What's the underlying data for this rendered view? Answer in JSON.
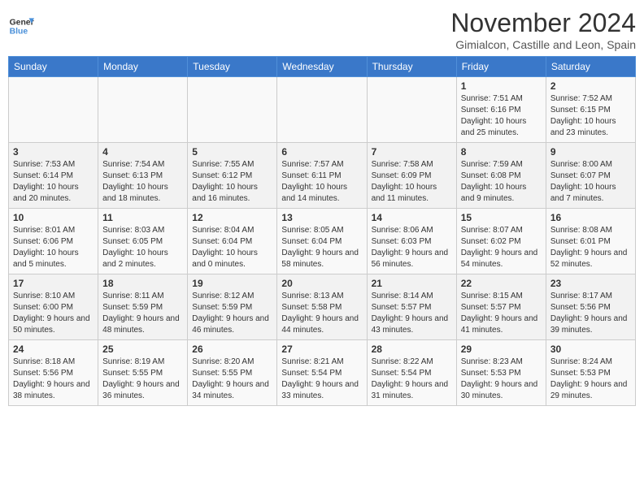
{
  "header": {
    "logo_line1": "General",
    "logo_line2": "Blue",
    "title": "November 2024",
    "subtitle": "Gimialcon, Castille and Leon, Spain"
  },
  "days_of_week": [
    "Sunday",
    "Monday",
    "Tuesday",
    "Wednesday",
    "Thursday",
    "Friday",
    "Saturday"
  ],
  "weeks": [
    [
      {
        "day": "",
        "info": ""
      },
      {
        "day": "",
        "info": ""
      },
      {
        "day": "",
        "info": ""
      },
      {
        "day": "",
        "info": ""
      },
      {
        "day": "",
        "info": ""
      },
      {
        "day": "1",
        "info": "Sunrise: 7:51 AM\nSunset: 6:16 PM\nDaylight: 10 hours and 25 minutes."
      },
      {
        "day": "2",
        "info": "Sunrise: 7:52 AM\nSunset: 6:15 PM\nDaylight: 10 hours and 23 minutes."
      }
    ],
    [
      {
        "day": "3",
        "info": "Sunrise: 7:53 AM\nSunset: 6:14 PM\nDaylight: 10 hours and 20 minutes."
      },
      {
        "day": "4",
        "info": "Sunrise: 7:54 AM\nSunset: 6:13 PM\nDaylight: 10 hours and 18 minutes."
      },
      {
        "day": "5",
        "info": "Sunrise: 7:55 AM\nSunset: 6:12 PM\nDaylight: 10 hours and 16 minutes."
      },
      {
        "day": "6",
        "info": "Sunrise: 7:57 AM\nSunset: 6:11 PM\nDaylight: 10 hours and 14 minutes."
      },
      {
        "day": "7",
        "info": "Sunrise: 7:58 AM\nSunset: 6:09 PM\nDaylight: 10 hours and 11 minutes."
      },
      {
        "day": "8",
        "info": "Sunrise: 7:59 AM\nSunset: 6:08 PM\nDaylight: 10 hours and 9 minutes."
      },
      {
        "day": "9",
        "info": "Sunrise: 8:00 AM\nSunset: 6:07 PM\nDaylight: 10 hours and 7 minutes."
      }
    ],
    [
      {
        "day": "10",
        "info": "Sunrise: 8:01 AM\nSunset: 6:06 PM\nDaylight: 10 hours and 5 minutes."
      },
      {
        "day": "11",
        "info": "Sunrise: 8:03 AM\nSunset: 6:05 PM\nDaylight: 10 hours and 2 minutes."
      },
      {
        "day": "12",
        "info": "Sunrise: 8:04 AM\nSunset: 6:04 PM\nDaylight: 10 hours and 0 minutes."
      },
      {
        "day": "13",
        "info": "Sunrise: 8:05 AM\nSunset: 6:04 PM\nDaylight: 9 hours and 58 minutes."
      },
      {
        "day": "14",
        "info": "Sunrise: 8:06 AM\nSunset: 6:03 PM\nDaylight: 9 hours and 56 minutes."
      },
      {
        "day": "15",
        "info": "Sunrise: 8:07 AM\nSunset: 6:02 PM\nDaylight: 9 hours and 54 minutes."
      },
      {
        "day": "16",
        "info": "Sunrise: 8:08 AM\nSunset: 6:01 PM\nDaylight: 9 hours and 52 minutes."
      }
    ],
    [
      {
        "day": "17",
        "info": "Sunrise: 8:10 AM\nSunset: 6:00 PM\nDaylight: 9 hours and 50 minutes."
      },
      {
        "day": "18",
        "info": "Sunrise: 8:11 AM\nSunset: 5:59 PM\nDaylight: 9 hours and 48 minutes."
      },
      {
        "day": "19",
        "info": "Sunrise: 8:12 AM\nSunset: 5:59 PM\nDaylight: 9 hours and 46 minutes."
      },
      {
        "day": "20",
        "info": "Sunrise: 8:13 AM\nSunset: 5:58 PM\nDaylight: 9 hours and 44 minutes."
      },
      {
        "day": "21",
        "info": "Sunrise: 8:14 AM\nSunset: 5:57 PM\nDaylight: 9 hours and 43 minutes."
      },
      {
        "day": "22",
        "info": "Sunrise: 8:15 AM\nSunset: 5:57 PM\nDaylight: 9 hours and 41 minutes."
      },
      {
        "day": "23",
        "info": "Sunrise: 8:17 AM\nSunset: 5:56 PM\nDaylight: 9 hours and 39 minutes."
      }
    ],
    [
      {
        "day": "24",
        "info": "Sunrise: 8:18 AM\nSunset: 5:56 PM\nDaylight: 9 hours and 38 minutes."
      },
      {
        "day": "25",
        "info": "Sunrise: 8:19 AM\nSunset: 5:55 PM\nDaylight: 9 hours and 36 minutes."
      },
      {
        "day": "26",
        "info": "Sunrise: 8:20 AM\nSunset: 5:55 PM\nDaylight: 9 hours and 34 minutes."
      },
      {
        "day": "27",
        "info": "Sunrise: 8:21 AM\nSunset: 5:54 PM\nDaylight: 9 hours and 33 minutes."
      },
      {
        "day": "28",
        "info": "Sunrise: 8:22 AM\nSunset: 5:54 PM\nDaylight: 9 hours and 31 minutes."
      },
      {
        "day": "29",
        "info": "Sunrise: 8:23 AM\nSunset: 5:53 PM\nDaylight: 9 hours and 30 minutes."
      },
      {
        "day": "30",
        "info": "Sunrise: 8:24 AM\nSunset: 5:53 PM\nDaylight: 9 hours and 29 minutes."
      }
    ]
  ]
}
